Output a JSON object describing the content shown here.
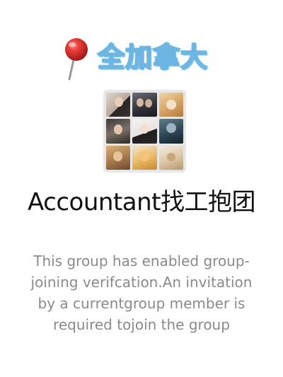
{
  "banner": {
    "location": "全加拿大",
    "icon": "map-pin-icon"
  },
  "group": {
    "avatar_tiles": 9,
    "name": "Accountant找工抱团"
  },
  "notice": {
    "lines": [
      "This group has enabled group-",
      "joining verifcation.An invitation",
      "by a currentgroup member is",
      "required tojoin the group"
    ]
  },
  "colors": {
    "background": "#ffffff",
    "banner_text_outline": "#6db6e3",
    "pin_red": "#e0302f",
    "notice_text": "#8a8a8a",
    "title_text": "#111111"
  }
}
